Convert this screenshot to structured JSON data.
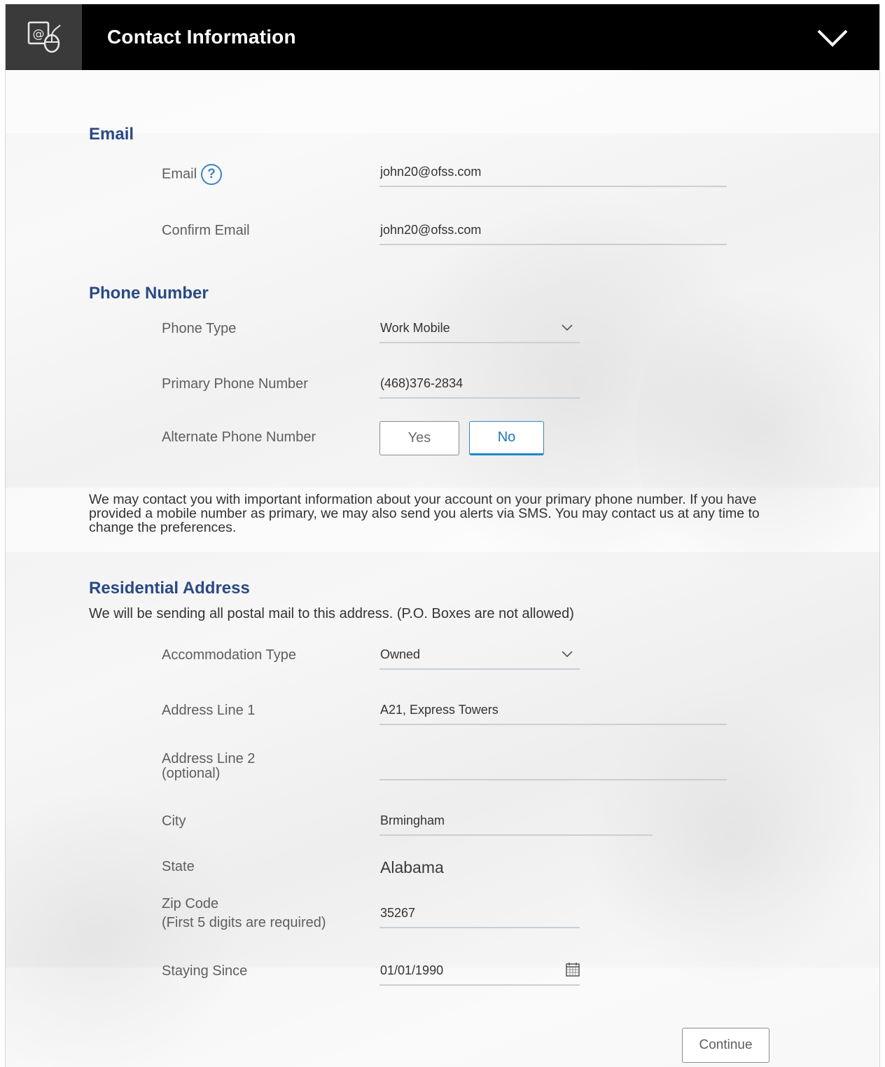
{
  "header": {
    "title": "Contact Information",
    "icon": "contact-envelope-mouse-icon"
  },
  "email_section": {
    "title": "Email",
    "email_label": "Email",
    "help_icon": "?",
    "email_value": "john20@ofss.com",
    "confirm_label": "Confirm Email",
    "confirm_value": "john20@ofss.com"
  },
  "phone_section": {
    "title": "Phone Number",
    "phone_type_label": "Phone Type",
    "phone_type_value": "Work Mobile",
    "primary_label": "Primary Phone Number",
    "primary_value": "(468)376-2834",
    "alternate_label": "Alternate Phone Number",
    "yes_label": "Yes",
    "no_label": "No",
    "selected": "No",
    "note": "We may contact you with important information about your account on your primary phone number. If you have provided a mobile number as primary, we may also send you alerts via SMS. You may contact us at any time to change the preferences."
  },
  "address_section": {
    "title": "Residential Address",
    "subtitle": "We will be sending all postal mail to this address. (P.O. Boxes are not allowed)",
    "accommodation_label": "Accommodation Type",
    "accommodation_value": "Owned",
    "line1_label": "Address Line 1",
    "line1_value": "A21, Express Towers",
    "line2_label": "Address Line 2",
    "line2_optional": "(optional)",
    "line2_value": "",
    "city_label": "City",
    "city_value": "Brmingham",
    "state_label": "State",
    "state_value": "Alabama",
    "zip_label": "Zip Code",
    "zip_hint": "(First 5 digits are required)",
    "zip_value": "35267",
    "since_label": "Staying Since",
    "since_value": "01/01/1990"
  },
  "actions": {
    "continue_label": "Continue"
  },
  "colors": {
    "header_bg": "#000000",
    "section_title": "#2a4a84",
    "accent": "#1b88c7"
  }
}
